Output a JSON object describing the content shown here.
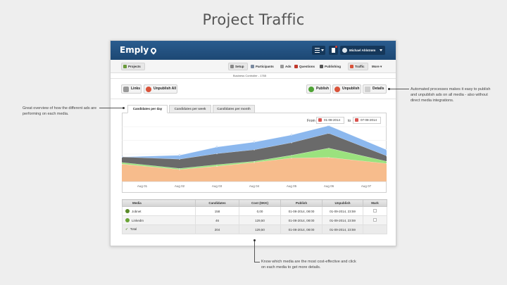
{
  "slide": {
    "title": "Project Traffic"
  },
  "topbar": {
    "logo": "Emply",
    "user_name": "Michael Ahlstrøm"
  },
  "nav": {
    "back_label": "Projects",
    "items": [
      {
        "label": "Setup",
        "icon": "gear-icon"
      },
      {
        "label": "Participants",
        "icon": "people-icon"
      },
      {
        "label": "Ads",
        "icon": "ads-icon"
      },
      {
        "label": "Questions",
        "icon": "question-icon"
      },
      {
        "label": "Publishing",
        "icon": "play-icon"
      },
      {
        "label": "Traffic",
        "icon": "traffic-icon"
      },
      {
        "label": "More",
        "icon": "chevron-down-icon"
      }
    ],
    "subtitle": "Business Controller - 1765"
  },
  "actions": {
    "links": "Links",
    "unpublish_all": "Unpublish All",
    "publish": "Publish",
    "unpublish": "Unpublish",
    "details": "Details"
  },
  "tabs": [
    {
      "label": "Candidates per day",
      "active": true
    },
    {
      "label": "Candidates per week",
      "active": false
    },
    {
      "label": "Candidates per month",
      "active": false
    }
  ],
  "date_range": {
    "from_label": "From",
    "from_value": "01-08-2014",
    "to_label": "to",
    "to_value": "07-08-2014"
  },
  "chart_data": {
    "type": "area",
    "categories": [
      "Aug 01",
      "Aug 02",
      "Aug 03",
      "Aug 04",
      "Aug 05",
      "Aug 06",
      "Aug 07"
    ],
    "stacked": true,
    "ylim": [
      0,
      100
    ],
    "grid": true,
    "legend": "none",
    "series": [
      {
        "color": "#f7bc8c",
        "values": [
          32,
          22,
          28,
          35,
          43,
          44,
          33
        ]
      },
      {
        "color": "#9be27e",
        "values": [
          3,
          2,
          3,
          2,
          5,
          17,
          4
        ]
      },
      {
        "color": "#6a6a6a",
        "values": [
          10,
          17,
          20,
          21,
          23,
          27,
          10
        ]
      },
      {
        "color": "#8cb8ee",
        "values": [
          0,
          7,
          12,
          14,
          14,
          14,
          11
        ]
      }
    ]
  },
  "table": {
    "headers": [
      "Media",
      "Candidates",
      "Cost (DKK)",
      "Publish",
      "Unpublish",
      "Mark"
    ],
    "rows": [
      {
        "media": "Jobnet",
        "candidates": "158",
        "cost": "0,00",
        "publish": "01-08-2014, 08:00",
        "unpublish": "01-09-2014, 23:59",
        "icon_color": "#5a8a2a"
      },
      {
        "media": "LinkedIn",
        "candidates": "46",
        "cost": "129,50",
        "publish": "01-08-2014, 08:00",
        "unpublish": "01-09-2014, 23:59",
        "icon_color": "#6aa434"
      }
    ],
    "total": {
      "media": "Total",
      "candidates": "204",
      "cost": "129,50",
      "publish": "01-08-2014, 08:00",
      "unpublish": "01-09-2014, 23:59"
    }
  },
  "callouts": {
    "left": "Great overview of how the different ads are performing on each media.",
    "right": "Automated processes makes it easy to publish and unpublish ads on all media - also without direct media integrations.",
    "bottom": "Know which media are the most cost-effective and click on each media to get more details."
  },
  "colors": {
    "topbar": "#1d4874",
    "publish_green": "#4fa336",
    "unpublish_red": "#d9533a"
  }
}
